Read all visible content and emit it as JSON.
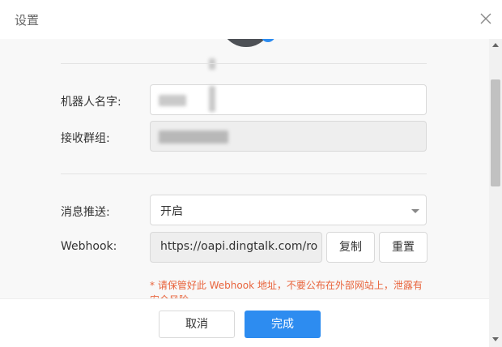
{
  "dialog": {
    "title": "设置"
  },
  "icons": {
    "close": "close-icon",
    "avatar": "robot-avatar",
    "dropdown": "chevron-down-icon"
  },
  "colors": {
    "primary": "#2d8cf0",
    "warning": "#e8643c"
  },
  "form": {
    "robot_name": {
      "label": "机器人名字:",
      "value": ""
    },
    "group": {
      "label": "接收群组:",
      "value": ""
    },
    "push": {
      "label": "消息推送:",
      "value": "开启"
    },
    "webhook": {
      "label": "Webhook:",
      "value": "https://oapi.dingtalk.com/ro",
      "copy_label": "复制",
      "reset_label": "重置"
    },
    "warning": "* 请保管好此 Webhook 地址，不要公布在外部网站上，泄露有安全风险"
  },
  "footer": {
    "cancel_label": "取消",
    "done_label": "完成"
  }
}
